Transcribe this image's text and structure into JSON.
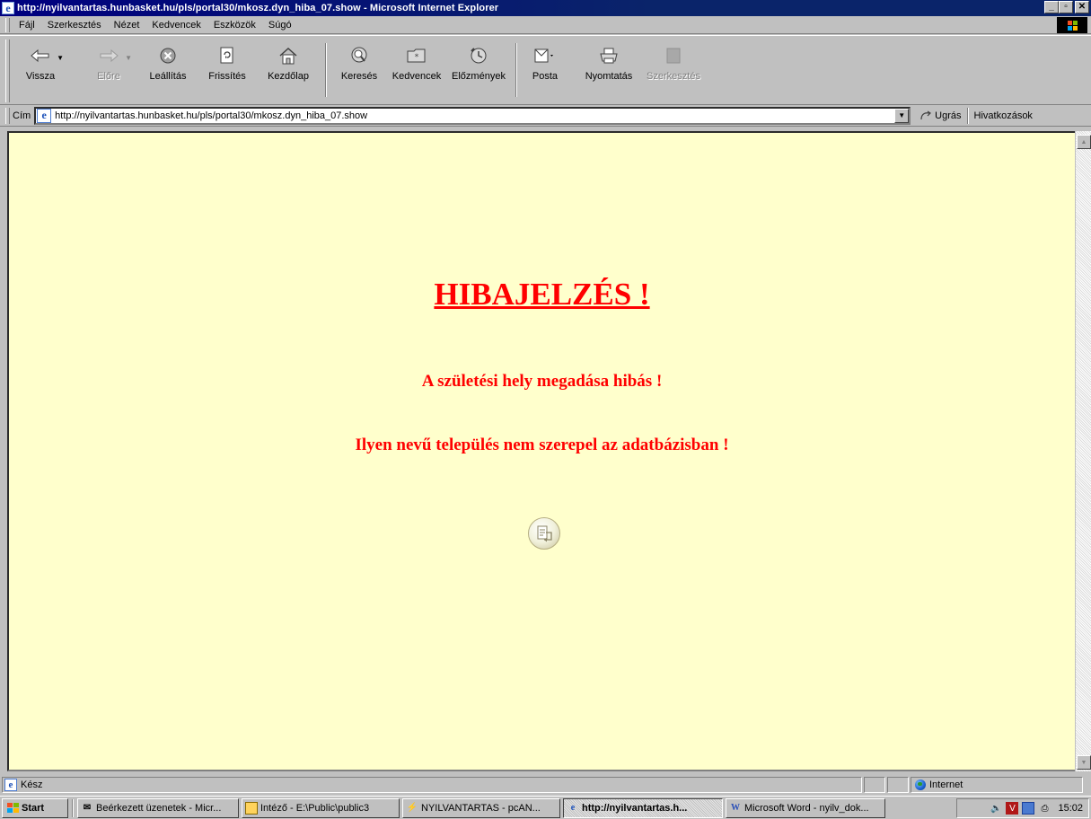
{
  "window": {
    "title": "http://nyilvantartas.hunbasket.hu/pls/portal30/mkosz.dyn_hiba_07.show - Microsoft Internet Explorer",
    "minimize_label": "_",
    "maximize_label": "▫",
    "close_label": "✕"
  },
  "menu": [
    "Fájl",
    "Szerkesztés",
    "Nézet",
    "Kedvencek",
    "Eszközök",
    "Súgó"
  ],
  "toolbar": {
    "back": "Vissza",
    "forward": "Előre",
    "stop": "Leállítás",
    "refresh": "Frissítés",
    "home": "Kezdőlap",
    "search": "Keresés",
    "favorites": "Kedvencek",
    "history": "Előzmények",
    "mail": "Posta",
    "print": "Nyomtatás",
    "edit": "Szerkesztés"
  },
  "address": {
    "label": "Cím",
    "url": "http://nyilvantartas.hunbasket.hu/pls/portal30/mkosz.dyn_hiba_07.show",
    "go_label": "Ugrás",
    "links_label": "Hivatkozások"
  },
  "page": {
    "heading": "HIBAJELZÉS !",
    "message1": "A születési hely megadása hibás !",
    "message2": "Ilyen nevű település nem szerepel az adatbázisban !",
    "text_color": "#ff0000",
    "background_color": "#ffffcc"
  },
  "status": {
    "text": "Kész",
    "zone": "Internet"
  },
  "taskbar": {
    "start": "Start",
    "tasks": [
      {
        "label": "Beérkezett üzenetek - Micr...",
        "icon": "inbox-icon",
        "active": false
      },
      {
        "label": "Intéző - E:\\Public\\public3",
        "icon": "explorer-icon",
        "active": false
      },
      {
        "label": "NYILVANTARTAS - pcAN...",
        "icon": "pcanywhere-icon",
        "active": false
      },
      {
        "label": "http://nyilvantartas.h...",
        "icon": "ie-icon",
        "active": true
      },
      {
        "label": "Microsoft Word - nyilv_dok...",
        "icon": "word-icon",
        "active": false
      }
    ],
    "clock": "15:02"
  }
}
